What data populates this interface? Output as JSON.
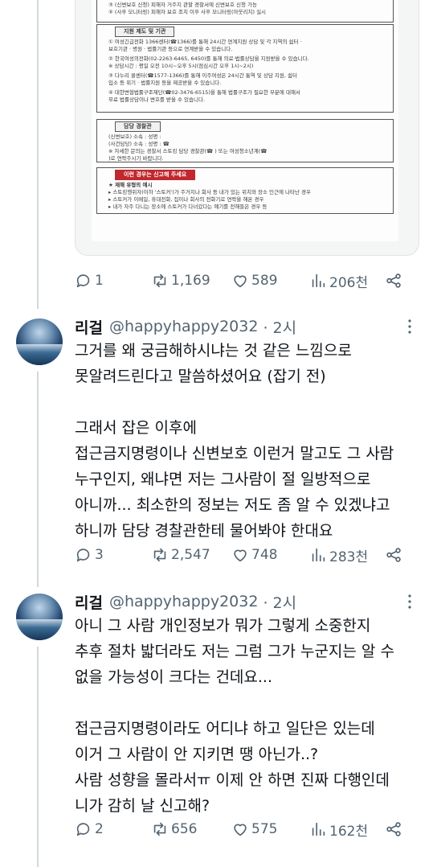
{
  "document_image": {
    "top_lines": [
      "③ (신변보호 신청) 피해자 거주지 관할 경찰서에 신변보호 신청 가능",
      "⑤ (사후 모니터링) 피해자 보호 조치 이후 사후 모니터링(아웃리치) 실시"
    ],
    "section_support": {
      "heading": "지원 제도 및 기관",
      "lines": [
        "① 여성긴급전화 1366센터(☎1366)를 통해 24시간 연계지원 상담 및 각 지역의 쉼터 ·",
        "   보호기관 · 병원 · 법률기관 등으로 연계받을 수 있습니다.",
        "② 한국여성의전화(02-2263-6465, 6450)를 통해 의료·법률상담을 지원받을 수 있습니다.",
        "   ※ 상담시간 : 평일 오전 10시~오후 5시(점심시간 오후 1시~2시)",
        "③ 다누리 콜센터(☎1577-1366)를 통해 이주여성은 24시간 통역 및 상담 지원, 쉼터",
        "   입소 등 위기 · 법률지원 등을 제공받을 수 있습니다.",
        "④ 대한변협법률구조재단(☎02-3476-6515)을 통해 법률구조가 필요한 부분에 대해서",
        "   무료 법률상담이나 변호를 받을 수 있습니다."
      ]
    },
    "section_officer": {
      "heading": "담당 경찰관",
      "lines": [
        "(신변보호) 소속 :                              성명 :",
        "(사건담당) 소속 :                              성명 :                  ☎",
        "※ 자세한 문의는 경찰서 스토킹 담당 경찰관(☎              ) 또는 여성청소년계(☎",
        "   )로 연락주시기 바랍니다."
      ]
    },
    "section_report": {
      "heading": "이런 경우는 신고해 주세요",
      "lines": [
        "★ 재해 유형의 예시",
        "▸ 스토킹행위자(이하 '스토커')가 주거지나 회사 등 내가 있는 위치와 장소 인근에 나타난 경우",
        "▸ 스토커가 이메일, 휴대전화, 집이나 회사의 전화기로 연락을 해온 경우",
        "▸ 내가 자주 다니는 장소에 스토커가 다녀갔다는 얘기를 전해들은 경우 등"
      ]
    }
  },
  "first_actions": {
    "replies": "1",
    "reposts": "1,169",
    "likes": "589",
    "views": "206천"
  },
  "tweets": [
    {
      "name": "리걸",
      "handle": "@happyhappy2032",
      "time": "· 2시",
      "lines": [
        "그거를 왜 궁금해하시냐는 것 같은 느낌으로",
        "못알려드린다고 말씀하셨어요 (잡기 전)",
        "",
        "그래서 잡은 이후에",
        "접근금지명령이나 신변보호 이런거 말고도 그 사람",
        "누구인지, 왜냐면 저는 그사람이 절 일방적으로",
        "아니까... 최소한의 정보는 저도 좀 알 수 있겠냐고",
        "하니까 담당 경찰관한테 물어봐야 한대요"
      ],
      "actions": {
        "replies": "3",
        "reposts": "2,547",
        "likes": "748",
        "views": "283천"
      }
    },
    {
      "name": "리걸",
      "handle": "@happyhappy2032",
      "time": "· 2시",
      "lines": [
        "아니 그 사람 개인정보가 뭐가 그렇게 소중한지",
        "추후 절차 밟더라도 저는 그럼 그가 누군지는 알 수",
        "없을 가능성이 크다는 건데요...",
        "",
        "접근금지명령이라도 어디냐 하고 일단은 있는데",
        "이거 그 사람이 안 지키면 땡 아닌가..?",
        "사람 성향을 몰라서ㅠ 이제 안 하면 진짜 다행인데",
        "니가 감히 날 신고해?"
      ],
      "actions": {
        "replies": "2",
        "reposts": "656",
        "likes": "575",
        "views": "162천"
      }
    }
  ],
  "icons": [
    "reply-icon",
    "repost-icon",
    "like-icon",
    "views-icon",
    "share-icon",
    "more-icon"
  ],
  "colors": {
    "text": "#0f1419",
    "secondary": "#536471",
    "thread_line": "#cfd9de",
    "report_heading": "#c1272d"
  }
}
